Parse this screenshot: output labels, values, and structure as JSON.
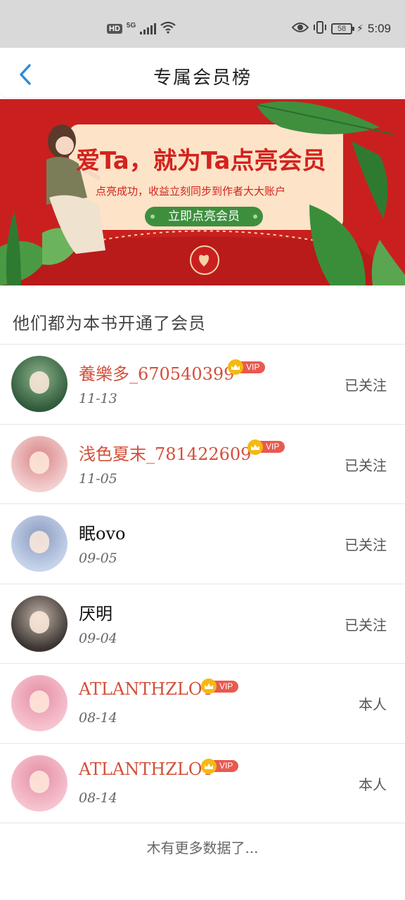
{
  "status_bar": {
    "hd": "HD",
    "network": "5G",
    "battery": "58",
    "time": "5:09",
    "icons": [
      "hd-icon",
      "signal-icon",
      "wifi-icon",
      "eye-icon",
      "vibrate-icon",
      "battery-icon",
      "charging-icon"
    ]
  },
  "header": {
    "title": "专属会员榜",
    "back_icon": "chevron-left-icon"
  },
  "banner": {
    "title": "爱Ta，就为Ta点亮会员",
    "subtitle": "点亮成功，收益立刻同步到作者大大账户",
    "button_label": "立即点亮会员",
    "colors": {
      "background": "#c9201f",
      "card": "#fde3c7",
      "button": "#3d8f3e"
    }
  },
  "section": {
    "title": "他们都为本书开通了会员"
  },
  "members": [
    {
      "name": "養樂多_670540399",
      "date": "11-13",
      "vip": true,
      "action": "已关注",
      "avatar_colors": [
        "#2f5a3a",
        "#8cb38a"
      ]
    },
    {
      "name": "浅色夏末_781422609",
      "date": "11-05",
      "vip": true,
      "action": "已关注",
      "avatar_colors": [
        "#f3cfcf",
        "#d9868a"
      ]
    },
    {
      "name": "眠ovo",
      "date": "09-05",
      "vip": false,
      "action": "已关注",
      "avatar_colors": [
        "#c6d3ea",
        "#8b9bc0"
      ]
    },
    {
      "name": "厌明",
      "date": "09-04",
      "vip": false,
      "action": "已关注",
      "avatar_colors": [
        "#3a3330",
        "#bfb2a8"
      ]
    },
    {
      "name": "ATLANTHZLOT",
      "date": "08-14",
      "vip": true,
      "action": "本人",
      "avatar_colors": [
        "#f6c3cf",
        "#e58ea6"
      ]
    },
    {
      "name": "ATLANTHZLOT",
      "date": "08-14",
      "vip": true,
      "action": "本人",
      "avatar_colors": [
        "#f6c3cf",
        "#e58ea6"
      ]
    }
  ],
  "vip_label": "VIP",
  "footer": {
    "text": "木有更多数据了..."
  },
  "colors": {
    "accent": "#2f8bd8",
    "vip_name": "#d2503a",
    "vip_badge": "#e85a4f",
    "crown": "#f5b913"
  }
}
